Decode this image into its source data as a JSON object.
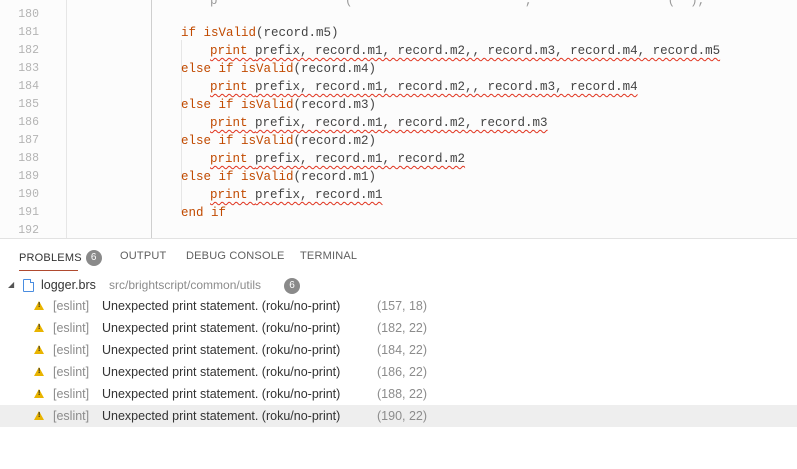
{
  "editor": {
    "lines": [
      {
        "num": "180",
        "indent": 0,
        "text": "",
        "kind": "blank"
      },
      {
        "num": "181",
        "indent": 1,
        "parts": [
          [
            "kw",
            "if "
          ],
          [
            "fn",
            "isValid"
          ],
          [
            "plain",
            "(record.m5)"
          ]
        ]
      },
      {
        "num": "182",
        "indent": 2,
        "parts": [
          [
            "kw",
            "print "
          ],
          [
            "plain",
            "prefix, record.m1, record.m2,, record.m3, record.m4, record.m5"
          ]
        ],
        "squiggle": true
      },
      {
        "num": "183",
        "indent": 1,
        "parts": [
          [
            "kw",
            "else if "
          ],
          [
            "fn",
            "isValid"
          ],
          [
            "plain",
            "(record.m4)"
          ]
        ]
      },
      {
        "num": "184",
        "indent": 2,
        "parts": [
          [
            "kw",
            "print "
          ],
          [
            "plain",
            "prefix, record.m1, record.m2,, record.m3, record.m4"
          ]
        ],
        "squiggle": true
      },
      {
        "num": "185",
        "indent": 1,
        "parts": [
          [
            "kw",
            "else if "
          ],
          [
            "fn",
            "isValid"
          ],
          [
            "plain",
            "(record.m3)"
          ]
        ]
      },
      {
        "num": "186",
        "indent": 2,
        "parts": [
          [
            "kw",
            "print "
          ],
          [
            "plain",
            "prefix, record.m1, record.m2, record.m3"
          ]
        ],
        "squiggle": true
      },
      {
        "num": "187",
        "indent": 1,
        "parts": [
          [
            "kw",
            "else if "
          ],
          [
            "fn",
            "isValid"
          ],
          [
            "plain",
            "(record.m2)"
          ]
        ]
      },
      {
        "num": "188",
        "indent": 2,
        "parts": [
          [
            "kw",
            "print "
          ],
          [
            "plain",
            "prefix, record.m1, record.m2"
          ]
        ],
        "squiggle": true
      },
      {
        "num": "189",
        "indent": 1,
        "parts": [
          [
            "kw",
            "else if "
          ],
          [
            "fn",
            "isValid"
          ],
          [
            "plain",
            "(record.m1)"
          ]
        ]
      },
      {
        "num": "190",
        "indent": 2,
        "parts": [
          [
            "kw",
            "print "
          ],
          [
            "plain",
            "prefix, record.m1"
          ]
        ],
        "squiggle": true
      },
      {
        "num": "191",
        "indent": 1,
        "parts": [
          [
            "kw",
            "end if"
          ]
        ]
      },
      {
        "num": "192",
        "indent": 0,
        "parts": []
      }
    ]
  },
  "panel": {
    "tabs": [
      {
        "label": "PROBLEMS",
        "badge": "6",
        "active": true
      },
      {
        "label": "OUTPUT"
      },
      {
        "label": "DEBUG CONSOLE"
      },
      {
        "label": "TERMINAL"
      }
    ],
    "file": {
      "name": "logger.brs",
      "path": "src/brightscript/common/utils",
      "count": "6"
    },
    "problems": [
      {
        "source": "[eslint]",
        "message": "Unexpected print statement. (roku/no-print)",
        "location": "(157, 18)"
      },
      {
        "source": "[eslint]",
        "message": "Unexpected print statement. (roku/no-print)",
        "location": "(182, 22)"
      },
      {
        "source": "[eslint]",
        "message": "Unexpected print statement. (roku/no-print)",
        "location": "(184, 22)"
      },
      {
        "source": "[eslint]",
        "message": "Unexpected print statement. (roku/no-print)",
        "location": "(186, 22)"
      },
      {
        "source": "[eslint]",
        "message": "Unexpected print statement. (roku/no-print)",
        "location": "(188, 22)"
      },
      {
        "source": "[eslint]",
        "message": "Unexpected print statement. (roku/no-print)",
        "location": "(190, 22)",
        "selected": true
      }
    ]
  },
  "colors": {
    "keyword": "#c14a00",
    "warning": "#e9b400",
    "squiggle": "#e0321d",
    "active_tab_underline": "#b04a2f"
  }
}
